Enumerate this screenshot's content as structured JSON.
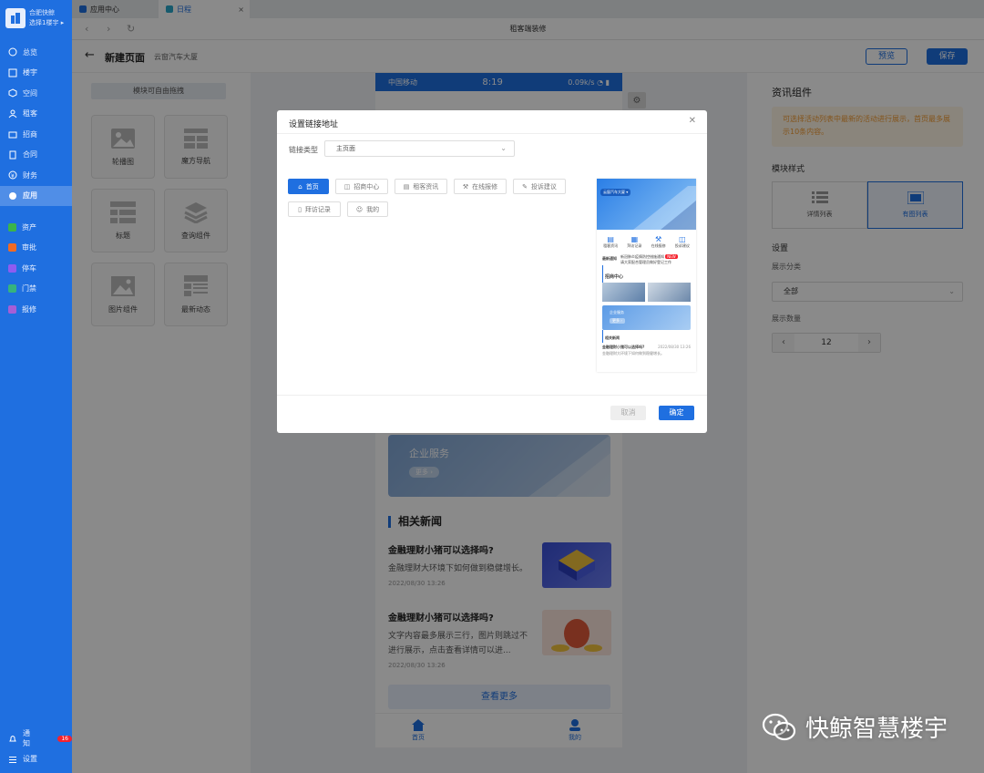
{
  "sidebar": {
    "company_line1": "合肥快鲸",
    "company_line2": "选择1楼宇",
    "items": [
      {
        "label": "总览"
      },
      {
        "label": "楼宇"
      },
      {
        "label": "空间"
      },
      {
        "label": "租客"
      },
      {
        "label": "招商"
      },
      {
        "label": "合同"
      },
      {
        "label": "财务"
      },
      {
        "label": "应用"
      }
    ],
    "apps": [
      {
        "label": "资产",
        "color": "#3bb44a"
      },
      {
        "label": "审批",
        "color": "#f06a24"
      },
      {
        "label": "停车",
        "color": "#8e5cf0"
      },
      {
        "label": "门禁",
        "color": "#36b37e"
      },
      {
        "label": "报修",
        "color": "#a55ed6"
      }
    ],
    "notify_label": "通知",
    "notify_count": "16",
    "settings_label": "设置"
  },
  "tabs": [
    {
      "label": "应用中心"
    },
    {
      "label": "日程"
    }
  ],
  "window_title": "租客端装修",
  "page": {
    "title": "新建页面",
    "subtitle": "云窗汽车大厦",
    "preview_label": "预览",
    "save_label": "保存"
  },
  "palette": {
    "header": "模块可自由拖拽",
    "components": [
      {
        "label": "轮播图"
      },
      {
        "label": "魔方导航"
      },
      {
        "label": "标题"
      },
      {
        "label": "查询组件"
      },
      {
        "label": "图片组件"
      },
      {
        "label": "最新动态"
      }
    ]
  },
  "phone": {
    "carrier": "中国移动",
    "time": "8:19",
    "speed": "0.09k/s",
    "enterprise_title": "企业服务",
    "enterprise_more": "更多 ›",
    "news_header": "相关新闻",
    "news": [
      {
        "title": "金融理财小猪可以选择吗?",
        "desc": "金融理财大环境下如何做到稳健增长。",
        "date": "2022/08/30 13:26"
      },
      {
        "title": "金融理财小猪可以选择吗?",
        "desc": "文字内容最多展示三行，图片则跳过不进行展示，点击查看详情可以进...",
        "date": "2022/08/30 13:26"
      }
    ],
    "more_label": "查看更多",
    "tab_home": "首页",
    "tab_mine": "我的"
  },
  "right_panel": {
    "title": "资讯组件",
    "tip": "可选择活动列表中最新的活动进行展示，首页最多展示10条内容。",
    "style_label": "模块样式",
    "style_options": [
      {
        "label": "详情列表"
      },
      {
        "label": "有图列表"
      }
    ],
    "settings_label": "设置",
    "category_label": "展示分类",
    "category_value": "全部",
    "count_label": "展示数量",
    "count_value": "12"
  },
  "modal": {
    "title": "设置链接地址",
    "link_type_label": "链接类型",
    "link_type_value": "主页面",
    "options": [
      {
        "label": "首页"
      },
      {
        "label": "招商中心"
      },
      {
        "label": "租客资讯"
      },
      {
        "label": "在线报修"
      },
      {
        "label": "投诉建议"
      },
      {
        "label": "拜访记录"
      },
      {
        "label": "我的"
      }
    ],
    "preview": {
      "banner": "云窗汽车大厦 ▾",
      "shortcuts": [
        {
          "label": "租客资讯"
        },
        {
          "label": "拜访记录"
        },
        {
          "label": "在线报修"
        },
        {
          "label": "投诉建议"
        }
      ],
      "notice_label": "最新通知",
      "notice_line1": "新冠肺炎疫情防控措施通知",
      "notice_line2": "请大家配合管理员做好登记工作",
      "notice_tag": "NEW",
      "recruit_header": "招商中心",
      "enterprise": "企业服务",
      "enterprise_more": "更多 ›",
      "news_header": "相关新闻",
      "news_title": "金融理财小猪可以选择吗?",
      "news_date": "2022/08/30 13:26",
      "news_desc": "金融理财大环境下如何做到稳健增长。"
    },
    "cancel_label": "取消",
    "ok_label": "确定"
  },
  "watermark": "快鲸智慧楼宇"
}
